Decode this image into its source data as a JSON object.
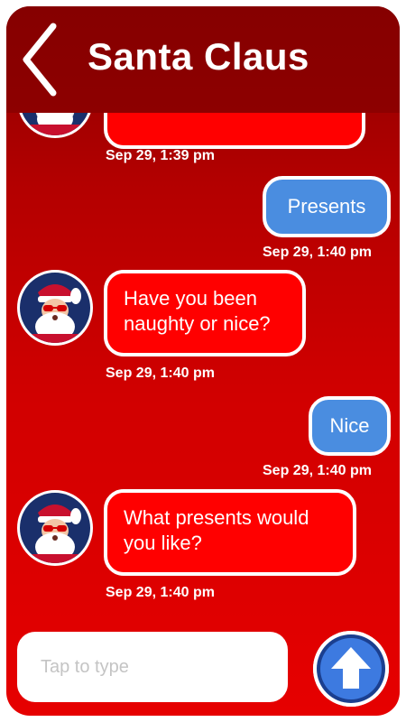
{
  "header": {
    "title": "Santa Claus",
    "back_icon": "chevron-left-icon"
  },
  "colors": {
    "header_bg": "#860000",
    "thread_bg_top": "#b30000",
    "thread_bg_bottom": "#e60000",
    "incoming_bubble": "#ff0000",
    "outgoing_bubble": "#4a8de0",
    "text": "#ffffff"
  },
  "messages": [
    {
      "direction": "incoming",
      "text": "",
      "timestamp": "Sep 29, 1:39 pm"
    },
    {
      "direction": "outgoing",
      "text": "Presents",
      "timestamp": "Sep 29, 1:40 pm"
    },
    {
      "direction": "incoming",
      "lines": [
        "Have you been",
        "naughty or nice?"
      ],
      "timestamp": "Sep 29, 1:40 pm"
    },
    {
      "direction": "outgoing",
      "text": "Nice",
      "timestamp": "Sep 29, 1:40 pm"
    },
    {
      "direction": "incoming",
      "lines": [
        "What presents would",
        "you like?"
      ],
      "timestamp": "Sep 29, 1:40 pm"
    }
  ],
  "composer": {
    "placeholder": "Tap to type",
    "send_icon": "arrow-up-icon"
  }
}
